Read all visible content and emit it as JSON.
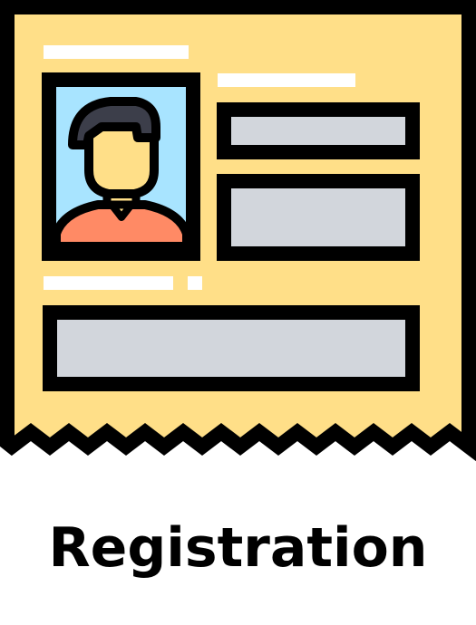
{
  "caption": "Registration",
  "icon": {
    "name": "registration-form-icon",
    "colors": {
      "outline": "#000000",
      "paper": "#FFDF88",
      "photo_background": "#A8E4FF",
      "skin": "#FFDF88",
      "hair": "#3C3E4A",
      "shirt": "#FF8A65",
      "collar": "#FFDF88",
      "placeholder_line": "#FFFFFF",
      "field": "#D2D6DC"
    }
  }
}
